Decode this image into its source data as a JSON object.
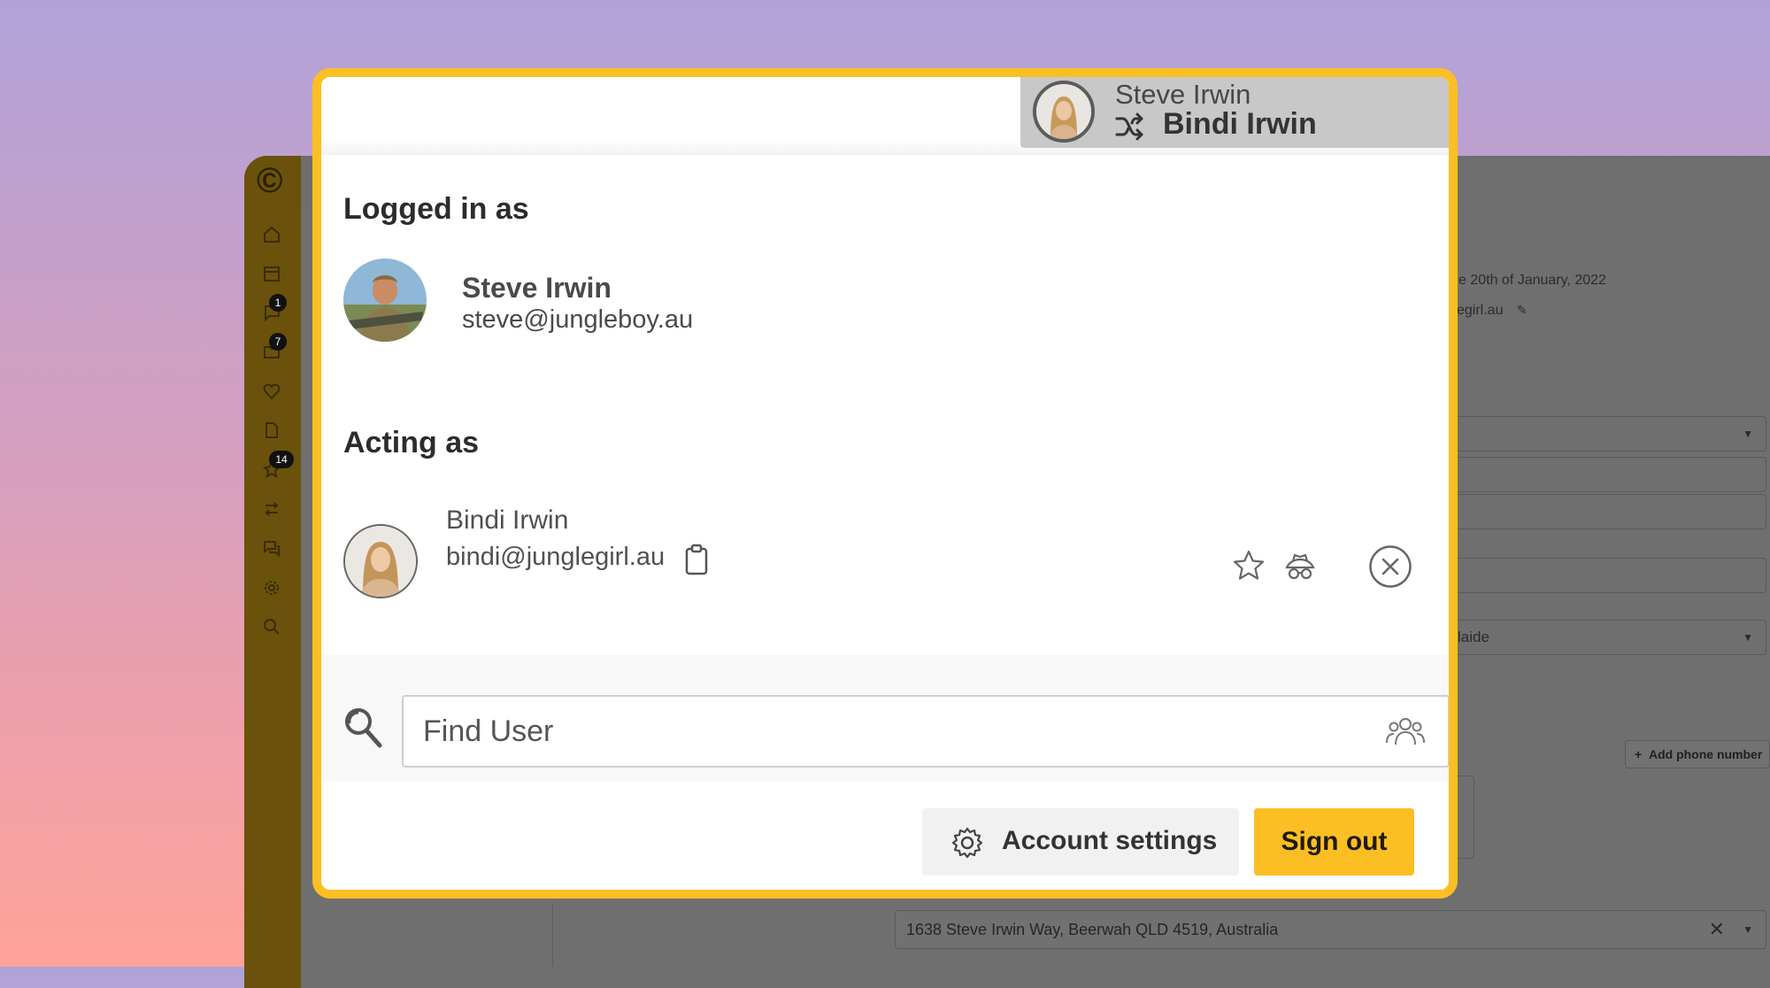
{
  "app": {
    "logo_glyph": "©",
    "nav": [
      {
        "icon": "home-icon",
        "badge": ""
      },
      {
        "icon": "calendar-icon",
        "badge": ""
      },
      {
        "icon": "chat-icon",
        "badge": "1"
      },
      {
        "icon": "folder-icon",
        "badge": "7"
      },
      {
        "icon": "heart-icon",
        "badge": ""
      },
      {
        "icon": "document-icon",
        "badge": ""
      },
      {
        "icon": "star-icon",
        "badge": "14"
      },
      {
        "icon": "swap-icon",
        "badge": ""
      },
      {
        "icon": "messages-icon",
        "badge": ""
      },
      {
        "icon": "settings-icon",
        "badge": ""
      },
      {
        "icon": "search-icon",
        "badge": ""
      }
    ],
    "fragments": {
      "date_text": "e 20th of January, 2022",
      "email_text": "egirl.au",
      "timezone_value": "laide",
      "add_phone_label": "Add phone number",
      "address_value": "1638 Steve Irwin Way, Beerwah QLD 4519, Australia"
    }
  },
  "popup": {
    "header": {
      "logged_in_name": "Steve Irwin",
      "acting_name": "Bindi Irwin"
    },
    "logged_in": {
      "heading": "Logged in as",
      "name": "Steve Irwin",
      "email": "steve@jungleboy.au"
    },
    "acting": {
      "heading": "Acting as",
      "name": "Bindi Irwin",
      "email": "bindi@junglegirl.au"
    },
    "search": {
      "placeholder": "Find User"
    },
    "actions": {
      "account_settings_label": "Account settings",
      "sign_out_label": "Sign out"
    }
  },
  "colors": {
    "accent": "#fbbf24",
    "sidebar": "#6a520c"
  }
}
